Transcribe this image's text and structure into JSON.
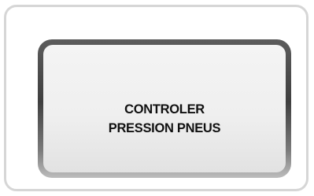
{
  "warning": {
    "line1": "CONTROLER",
    "line2": "PRESSION PNEUS"
  }
}
